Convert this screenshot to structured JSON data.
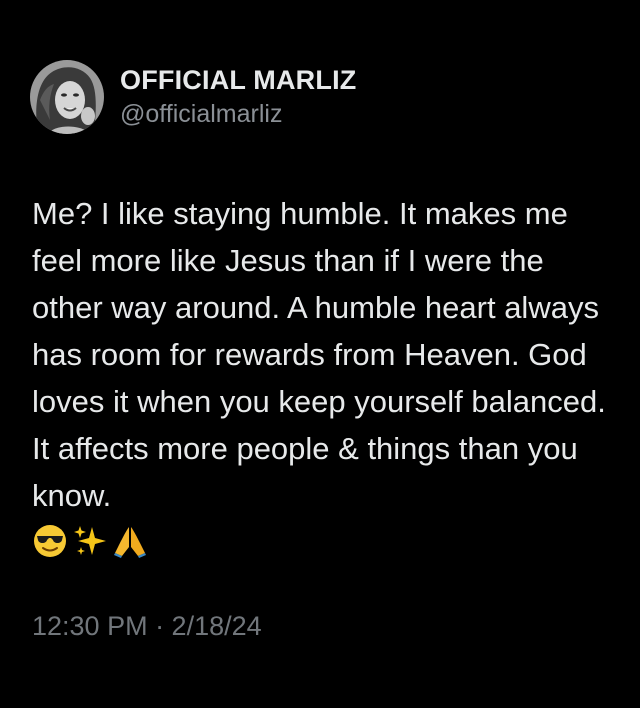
{
  "author": {
    "display_name": "OFFICIAL MARLIZ",
    "handle": "@officialmarliz",
    "avatar_icon": "profile-photo"
  },
  "tweet": {
    "text": "Me? I like staying humble. It makes me feel more like Jesus than if I were the other way around. A humble heart always has room for rewards from Heaven. God loves it when you keep yourself balanced. It affects more people & things than you know.",
    "emojis": [
      "smiling-face-with-sunglasses-icon",
      "sparkles-icon",
      "folded-hands-icon"
    ],
    "timestamp": "12:30 PM · 2/18/24"
  },
  "colors": {
    "background": "#000000",
    "text_primary": "#e7e9ea",
    "text_secondary": "#71767b"
  }
}
